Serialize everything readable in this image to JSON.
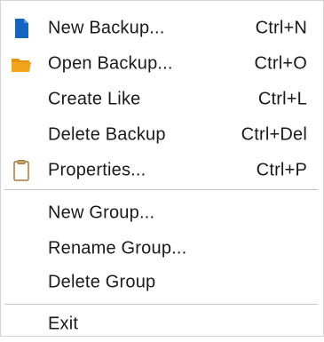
{
  "menu": {
    "items": [
      {
        "label": "New Backup...",
        "shortcut": "Ctrl+N",
        "icon": "new-document-icon"
      },
      {
        "label": "Open Backup...",
        "shortcut": "Ctrl+O",
        "icon": "open-folder-icon"
      },
      {
        "label": "Create Like",
        "shortcut": "Ctrl+L"
      },
      {
        "label": "Delete Backup",
        "shortcut": "Ctrl+Del"
      },
      {
        "label": "Properties...",
        "shortcut": "Ctrl+P",
        "icon": "properties-icon"
      },
      {
        "label": "New Group..."
      },
      {
        "label": "Rename Group..."
      },
      {
        "label": "Delete Group"
      },
      {
        "label": "Exit"
      }
    ]
  },
  "colors": {
    "document_blue": "#1565c0",
    "folder_orange": "#f2a51a",
    "properties_tan": "#caa166",
    "separator": "#c8c8c8"
  }
}
